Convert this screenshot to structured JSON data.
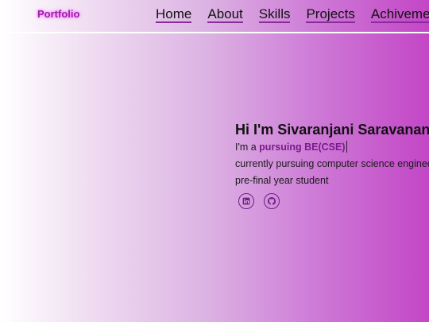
{
  "navbar": {
    "logo": "Portfolio",
    "links": [
      "Home",
      "About",
      "Skills",
      "Projects",
      "Achivements"
    ]
  },
  "hero": {
    "title": "Hi I'm Sivaranjani Saravanan",
    "intro_prefix": "I'm a ",
    "intro_highlight": "pursuing BE(CSE)",
    "line2": "currently pursuing computer science engineering",
    "line3": "pre-final year student"
  },
  "socials": [
    {
      "icon": "linkedin-icon"
    },
    {
      "icon": "github-icon"
    }
  ],
  "colors": {
    "accent": "#9b1fa8",
    "gradient_start": "#ffffff",
    "gradient_end": "#c346c6"
  }
}
